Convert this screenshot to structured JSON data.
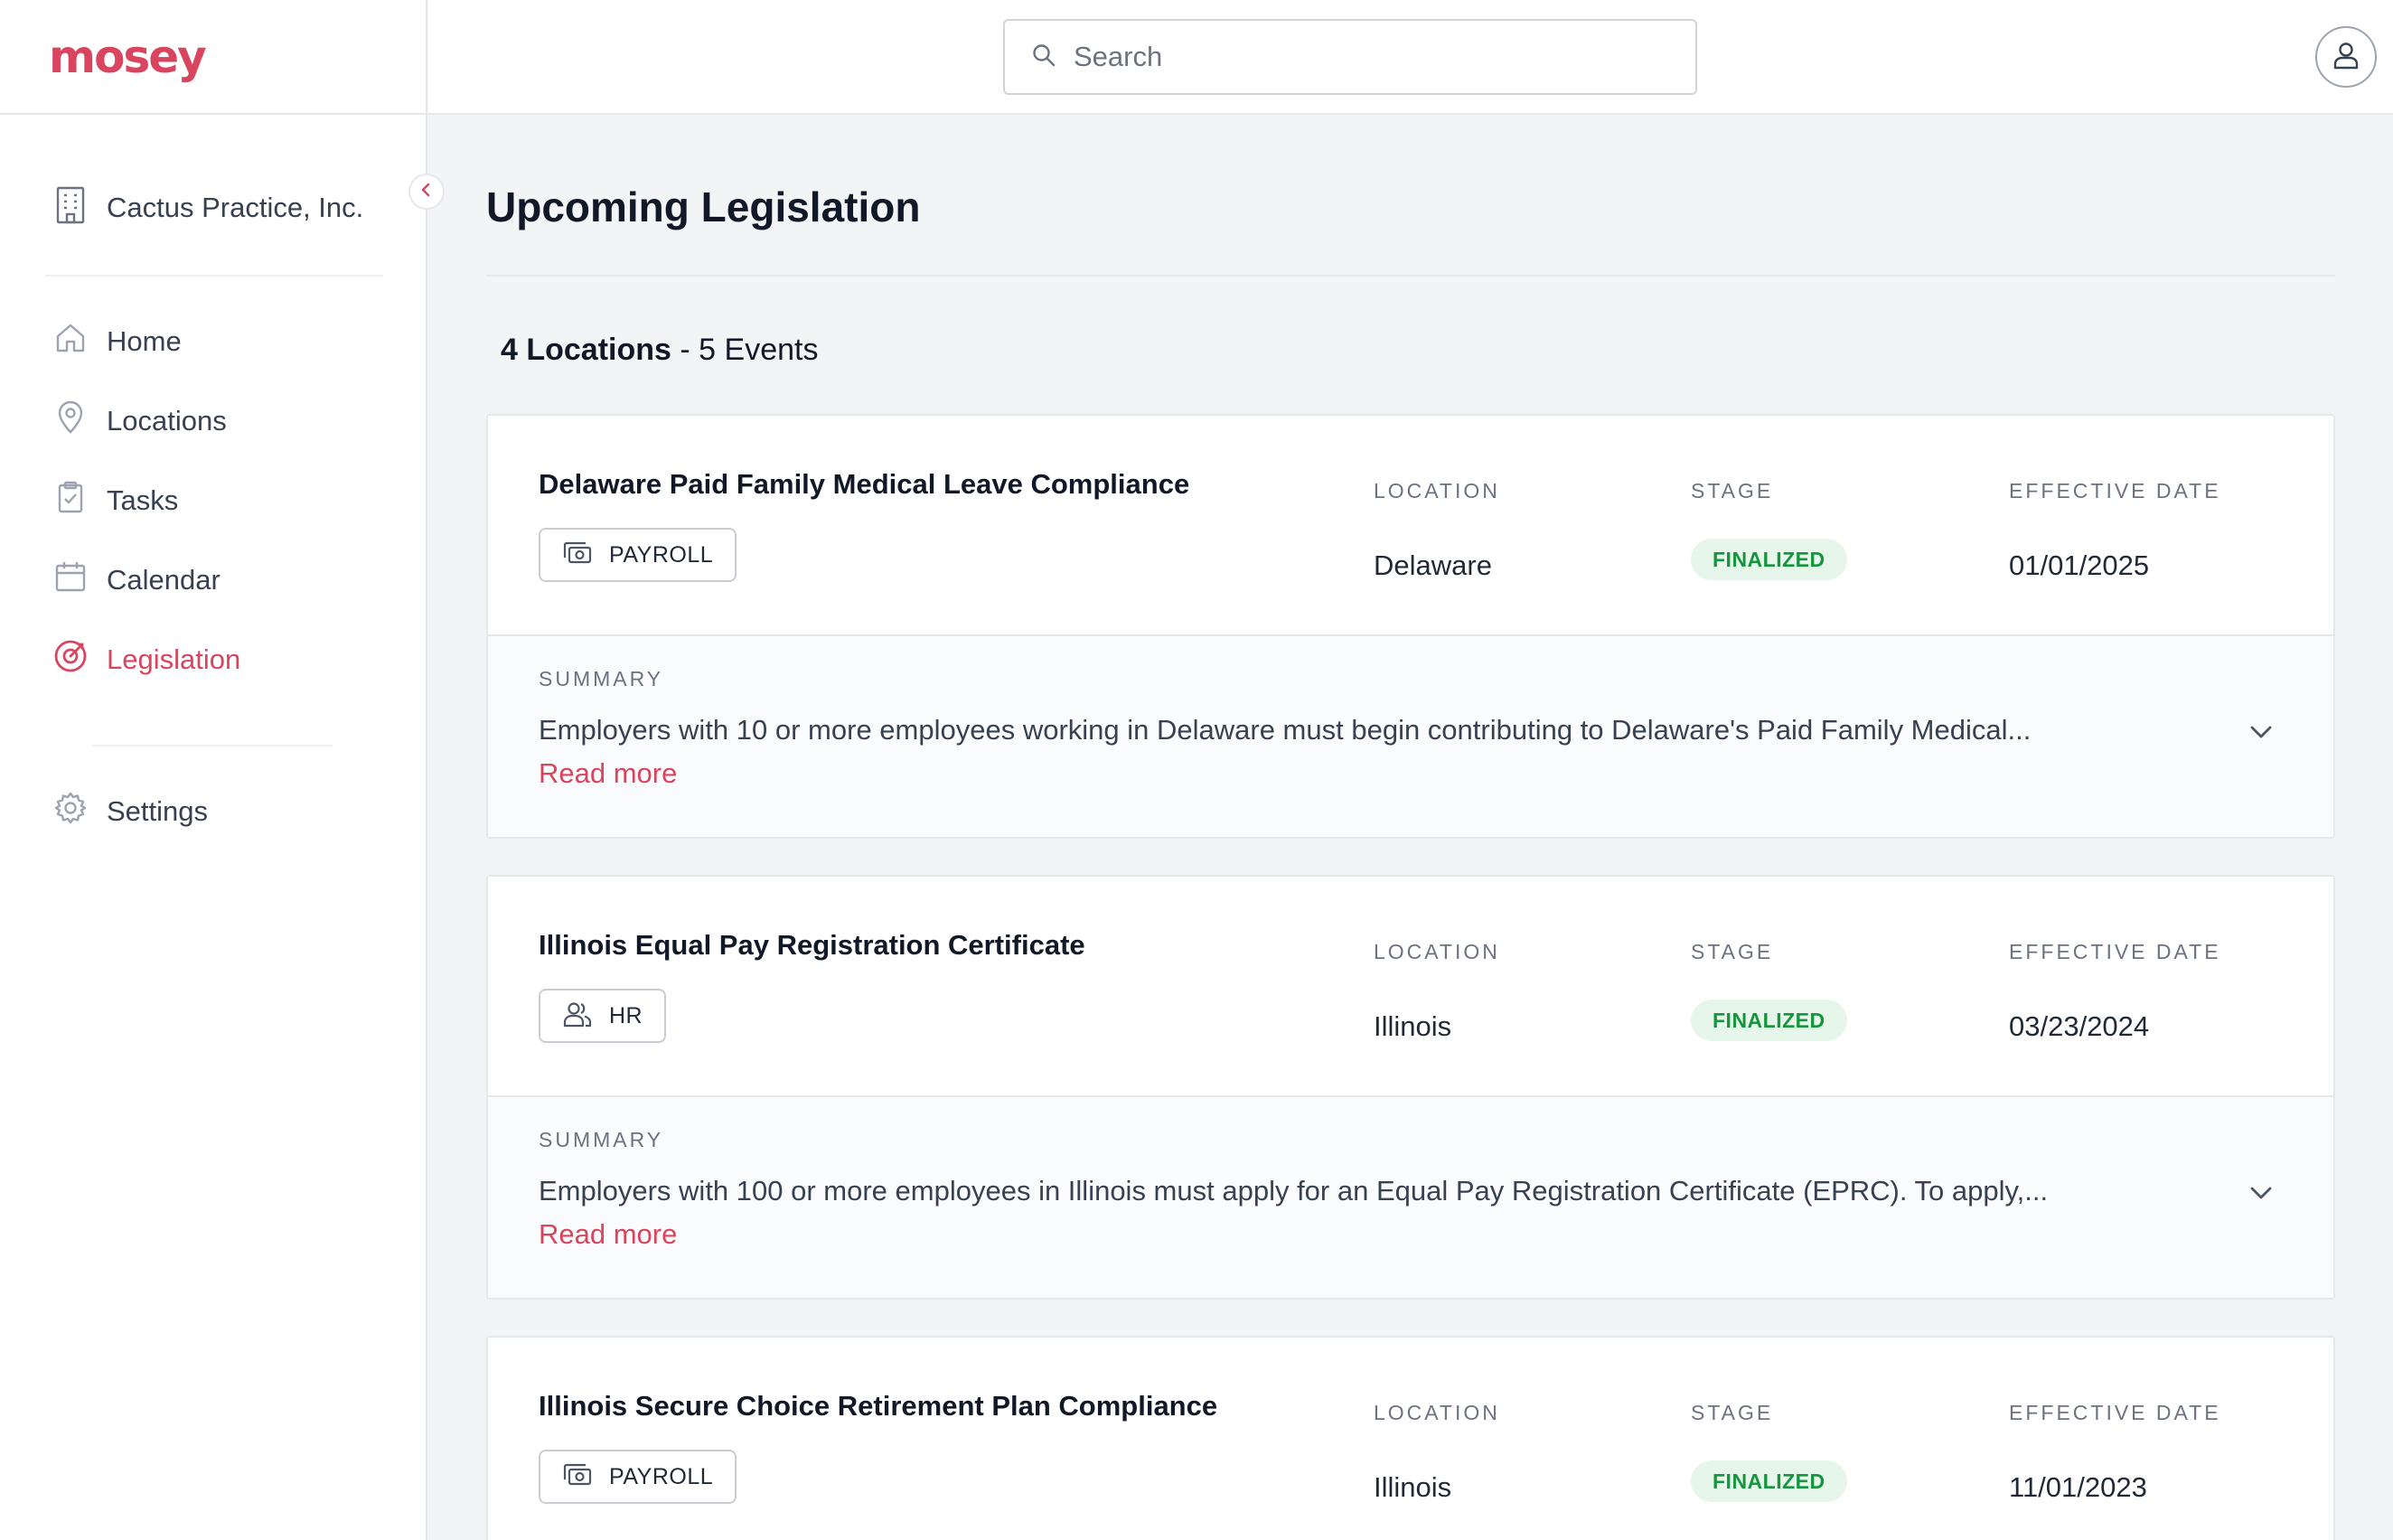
{
  "app": {
    "logo": "mosey",
    "org_name": "Cactus Practice, Inc."
  },
  "nav": {
    "items": [
      {
        "label": "Home",
        "icon": "home-icon"
      },
      {
        "label": "Locations",
        "icon": "map-pin-icon"
      },
      {
        "label": "Tasks",
        "icon": "clipboard-check-icon"
      },
      {
        "label": "Calendar",
        "icon": "calendar-icon"
      },
      {
        "label": "Legislation",
        "icon": "target-icon",
        "active": true
      },
      {
        "label": "Settings",
        "icon": "gear-icon"
      }
    ]
  },
  "search": {
    "placeholder": "Search",
    "value": ""
  },
  "page": {
    "title": "Upcoming Legislation",
    "locations_count": "4 Locations",
    "events_count": "- 5 Events"
  },
  "columns": {
    "location": "LOCATION",
    "stage": "STAGE",
    "effective_date": "EFFECTIVE DATE",
    "summary": "SUMMARY",
    "read_more": "Read more"
  },
  "events": [
    {
      "title": "Delaware Paid Family Medical Leave Compliance",
      "tag": "PAYROLL",
      "tag_icon": "payroll-icon",
      "location": "Delaware",
      "stage": "FINALIZED",
      "effective_date": "01/01/2025",
      "summary": "Employers with 10 or more employees working in Delaware must begin contributing to Delaware's Paid Family Medical..."
    },
    {
      "title": "Illinois Equal Pay Registration Certificate",
      "tag": "HR",
      "tag_icon": "users-icon",
      "location": "Illinois",
      "stage": "FINALIZED",
      "effective_date": "03/23/2024",
      "summary": "Employers with 100 or more employees in Illinois must apply for an Equal Pay Registration Certificate (EPRC). To apply,..."
    },
    {
      "title": "Illinois Secure Choice Retirement Plan Compliance",
      "tag": "PAYROLL",
      "tag_icon": "payroll-icon",
      "location": "Illinois",
      "stage": "FINALIZED",
      "effective_date": "11/01/2023",
      "summary": ""
    }
  ],
  "colors": {
    "brand": "#d9455f",
    "finalized_bg": "#e7f6ea",
    "finalized_text": "#15963e"
  }
}
